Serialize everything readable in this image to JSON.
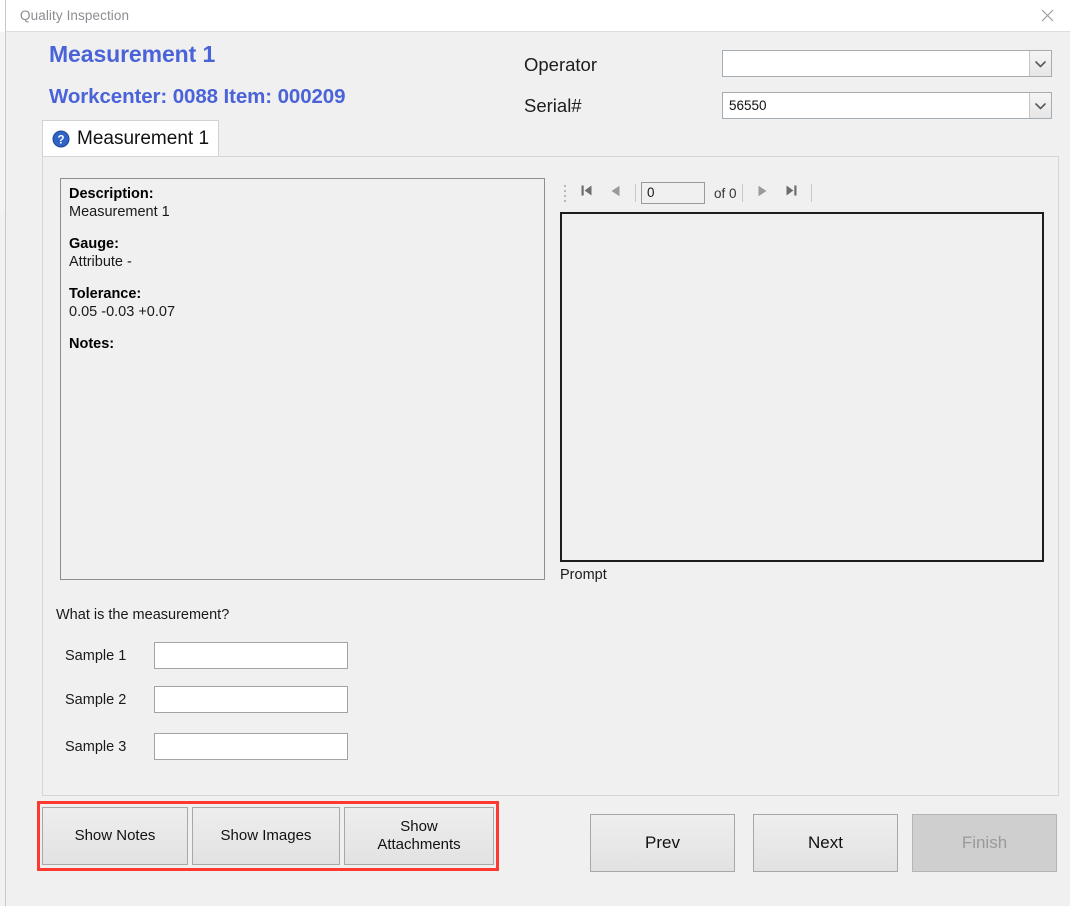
{
  "window": {
    "title": "Quality Inspection",
    "close_icon": "close-icon"
  },
  "header": {
    "measurement_title": "Measurement 1",
    "workcenter_line": "Workcenter: 0088 Item: 000209",
    "operator_label": "Operator",
    "operator_value": "",
    "serial_label": "Serial#",
    "serial_value": "56550",
    "dropdown_icon": "chevron-down-icon"
  },
  "tabs": [
    {
      "label": "Measurement 1",
      "icon": "question-badge-icon",
      "selected": true
    }
  ],
  "description_panel": {
    "fields": [
      {
        "key": "Description:",
        "value": "Measurement 1"
      },
      {
        "key": "Gauge:",
        "value": "Attribute -"
      },
      {
        "key": "Tolerance:",
        "value": "0.05 -0.03 +0.07"
      },
      {
        "key": "Notes:",
        "value": ""
      }
    ]
  },
  "record_nav": {
    "first_icon": "first-record-icon",
    "prev_icon": "prev-record-icon",
    "position": "0",
    "count_label": "of 0",
    "next_icon": "next-record-icon",
    "last_icon": "last-record-icon"
  },
  "prompt": {
    "label": "Prompt",
    "content": ""
  },
  "question": {
    "text": "What is the measurement?",
    "samples": [
      {
        "label": "Sample 1",
        "value": ""
      },
      {
        "label": "Sample 2",
        "value": ""
      },
      {
        "label": "Sample 3",
        "value": ""
      }
    ]
  },
  "actions": {
    "show_notes": "Show Notes",
    "show_images": "Show Images",
    "show_attachments_line1": "Show",
    "show_attachments_line2": "Attachments",
    "prev": "Prev",
    "next": "Next",
    "finish": "Finish"
  },
  "colors": {
    "heading_blue": "#4a63d8",
    "highlight_red": "#fe3a30",
    "form_background": "#f0f0f0",
    "disabled_text": "#9a9a9a"
  }
}
